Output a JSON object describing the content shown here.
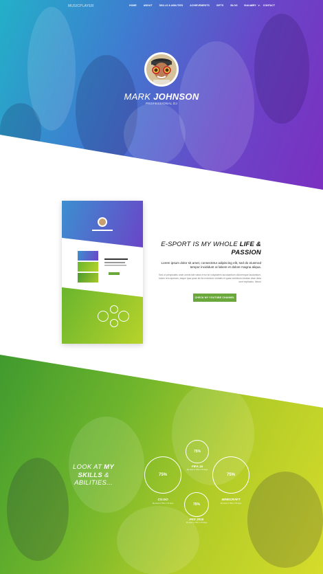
{
  "nav": {
    "logo_main": "MUSIC",
    "logo_sub": "PLAYER",
    "items": [
      "HOME",
      "ABOUT",
      "SKILLS & ABILITIES",
      "ACHIEVEMENTS",
      "GIFTS",
      "BLOG",
      "GALLERY",
      "CONTACT"
    ],
    "social": [
      "f",
      "tw",
      "in"
    ]
  },
  "hero": {
    "first_name": "MARK",
    "last_name": "JOHNSON",
    "subtitle": "PROFESSIONAL DJ"
  },
  "about": {
    "title_line1": "E-SPORT IS MY WHOLE",
    "title_emph1": "LIFE &",
    "title_emph2": "PASSION",
    "lead": "Lorem ipsum dolor sit amet, consectetur adipiscing elit, sed do eiusmod tempor incididunt ut labore et dolore magna aliqua.",
    "body": "Sed ut perspiciatis unde omnis iste natus error sit voluptatem accusantium doloremque laudantium, totam rem aperiam, eaque ipsa quae ab illo inventore veritatis et quasi architecto beatae vitae dicta sunt explicabo. Nemo",
    "button": "CHECK MY YOUTUBE CHANNEL"
  },
  "skills": {
    "title_line1": "LOOK AT",
    "title_emph1": "MY SKILLS",
    "title_line2": "&",
    "title_line3": "ABILITIES...",
    "items": [
      {
        "name": "CS:GO",
        "percent": "75%",
        "sub": "My level is 75% in 75 days"
      },
      {
        "name": "FIFA 15",
        "percent": "75%",
        "sub": "My level is 75% in 75 days"
      },
      {
        "name": "MINECRAFT",
        "percent": "75%",
        "sub": "My level is 75% in 75 days"
      },
      {
        "name": "PES 2015",
        "percent": "75%",
        "sub": "My level is 75% in 75 days"
      }
    ]
  },
  "colors": {
    "hero_start": "#23b0c8",
    "hero_end": "#7b2fc0",
    "accent_green": "#6ba83b",
    "skills_start": "#3f9a2e",
    "skills_end": "#d6dc2a"
  }
}
